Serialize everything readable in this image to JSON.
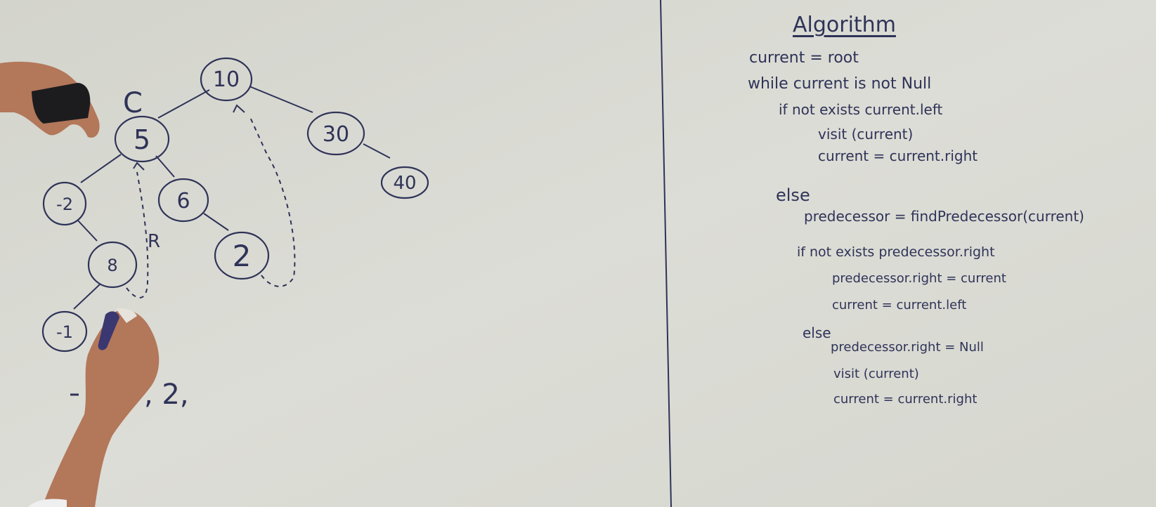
{
  "tree": {
    "nodes": [
      {
        "id": "n10",
        "label": "10"
      },
      {
        "id": "n5",
        "label": "5"
      },
      {
        "id": "n30",
        "label": "30"
      },
      {
        "id": "n40",
        "label": "40"
      },
      {
        "id": "nm2",
        "label": "-2"
      },
      {
        "id": "n6",
        "label": "6"
      },
      {
        "id": "n2",
        "label": "2"
      },
      {
        "id": "n8",
        "label": "8"
      },
      {
        "id": "nm1",
        "label": "-1"
      }
    ],
    "current_marker": "C",
    "right_thread_marker": "R",
    "traversal_output": ", 2,"
  },
  "algorithm": {
    "title": "Algorithm",
    "lines": [
      "current = root",
      "while current is not Null",
      "if not exists current.left",
      "visit (current)",
      "current = current.right",
      "else",
      "predecessor = findPredecessor(current)",
      "if not exists predecessor.right",
      "predecessor.right = current",
      "current = current.left",
      "else",
      "predecessor.right = Null",
      "visit (current)",
      "current = current.right"
    ]
  },
  "colors": {
    "board": "#d9dad2",
    "marker_ink": "#2f3358",
    "skin": "#b3775a"
  }
}
